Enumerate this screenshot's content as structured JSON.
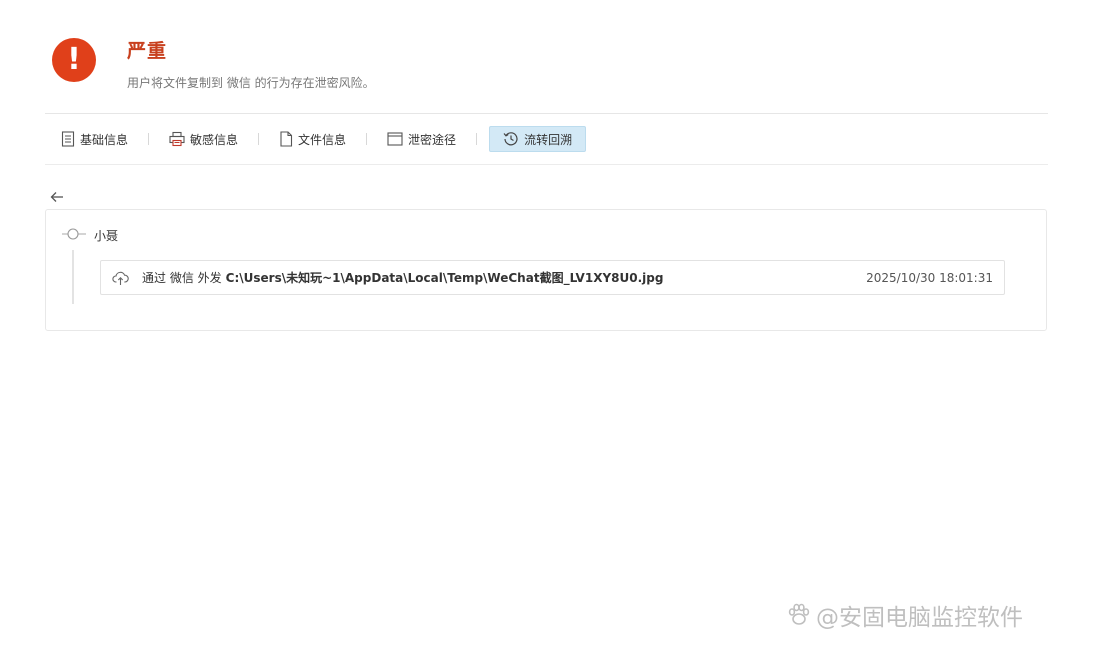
{
  "alert": {
    "icon": "exclamation-circle-icon",
    "icon_color": "#e0401a",
    "mark": "!",
    "title": "严重",
    "title_color": "#c8401e",
    "description": "用户将文件复制到 微信 的行为存在泄密风险。"
  },
  "tabs": [
    {
      "label": "基础信息",
      "icon": "document-list-icon",
      "active": false
    },
    {
      "label": "敏感信息",
      "icon": "printer-icon",
      "active": false
    },
    {
      "label": "文件信息",
      "icon": "file-icon",
      "active": false
    },
    {
      "label": "泄密途径",
      "icon": "window-icon",
      "active": false
    },
    {
      "label": "流转回溯",
      "icon": "history-clock-icon",
      "active": true
    }
  ],
  "active_tab_color": "#d3e9f6",
  "back_icon": "arrow-left-icon",
  "trace": {
    "user": "小聂",
    "event": {
      "icon": "cloud-upload-icon",
      "prefix": "通过 微信 外发",
      "path": "C:\\Users\\未知玩~1\\AppData\\Local\\Temp\\WeChat截图_LV1XY8U0.jpg",
      "timestamp": "2025/10/30 18:01:31"
    }
  },
  "watermark": {
    "icon": "paw-icon",
    "text": "@安固电脑监控软件"
  }
}
